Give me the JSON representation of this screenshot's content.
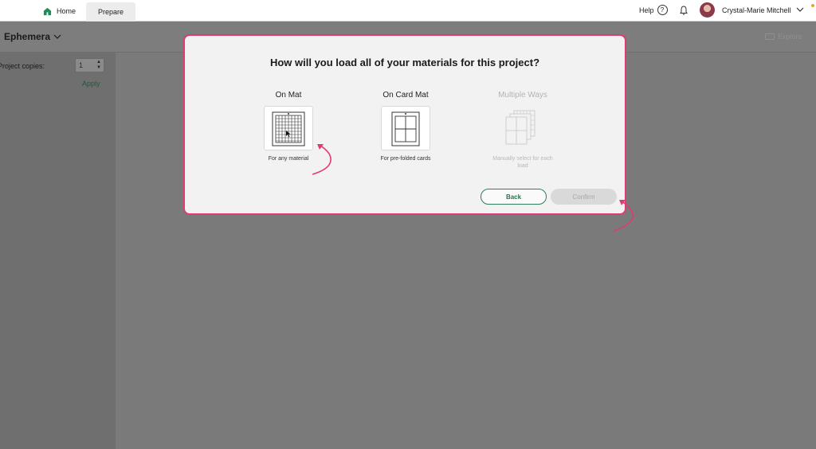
{
  "nav": {
    "home_label": "Home",
    "prepare_label": "Prepare",
    "help_label": "Help",
    "help_icon_glyph": "?",
    "user_name": "Crystal-Marie Mitchell"
  },
  "project": {
    "title": "Ephemera",
    "explore_label": "Explore"
  },
  "left_panel": {
    "copies_label": "Project copies:",
    "copies_value": "1",
    "stepper_up": "▲",
    "stepper_down": "▼",
    "apply_label": "Apply"
  },
  "modal": {
    "title": "How will you load all of your materials for this project?",
    "options": [
      {
        "label": "On Mat",
        "subtitle": "For any material",
        "icon": "mat-grid-icon",
        "enabled": true
      },
      {
        "label": "On Card Mat",
        "subtitle": "For pre-folded cards",
        "icon": "card-mat-icon",
        "enabled": true
      },
      {
        "label": "Multiple Ways",
        "subtitle": "Manually select for each load",
        "icon": "multiple-mats-icon",
        "enabled": false
      }
    ],
    "back_label": "Back",
    "confirm_label": "Confirm"
  },
  "colors": {
    "accent_green": "#2f7d5a",
    "annotation_pink": "#de3b76",
    "overlay_gray": "#7a7a7a"
  }
}
